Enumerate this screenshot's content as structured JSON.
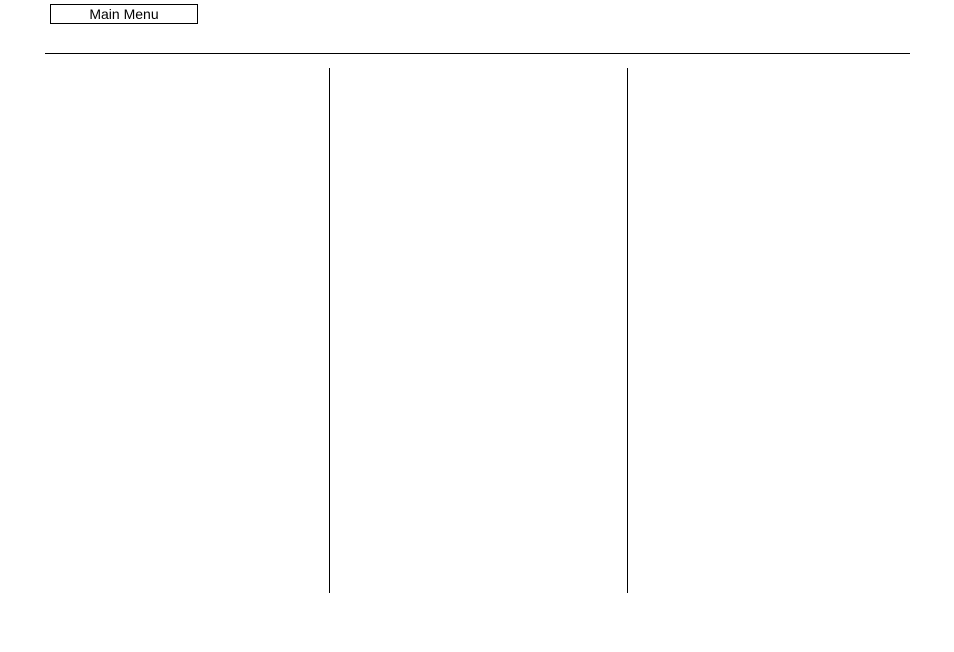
{
  "header": {
    "main_menu_label": "Main Menu"
  }
}
